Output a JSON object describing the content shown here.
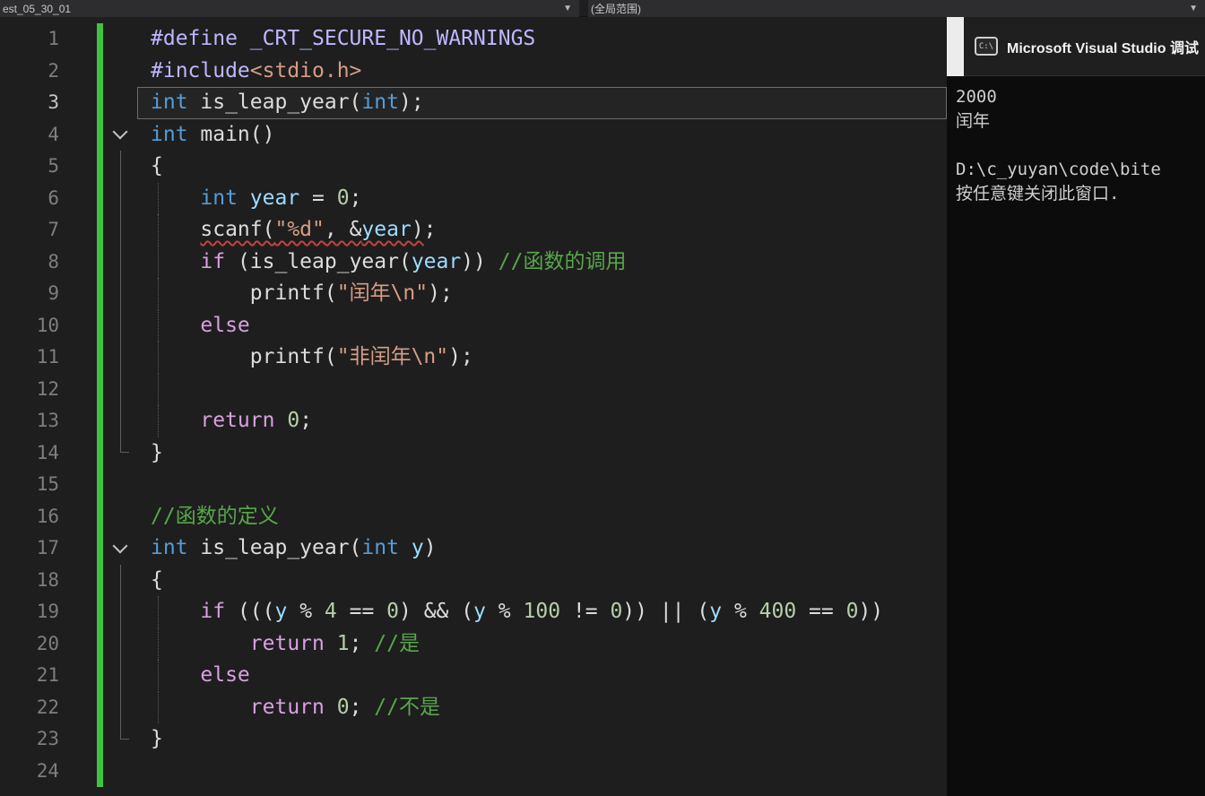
{
  "navbar": {
    "scope_dropdown": {
      "label": "est_05_30_01"
    },
    "member_dropdown": {
      "label": "(全局范围)"
    }
  },
  "palette": {
    "editor_background": "#1e1e1e",
    "keyword_blue": "#569cd6",
    "control_keyword_purple": "#d8a0df",
    "string_orange": "#d69d85",
    "number_green": "#b5cea8",
    "variable_blue": "#9cdcfe",
    "comment_green": "#57a64a",
    "preprocessor_purple": "#beb7ff",
    "changed_line_bar_green": "#3fc43f",
    "squiggle_red": "#c14343",
    "console_background": "#0c0c0c"
  },
  "editor": {
    "fold_ranges": [
      [
        4,
        14
      ],
      [
        17,
        23
      ]
    ],
    "lines": [
      {
        "num": 1,
        "segs": [
          [
            "pre",
            "#define _CRT_SECURE_NO_WARNINGS"
          ]
        ]
      },
      {
        "num": 2,
        "segs": [
          [
            "pre",
            "#include"
          ],
          [
            "str",
            "<stdio.h>"
          ]
        ]
      },
      {
        "num": 3,
        "active": true,
        "segs": [
          [
            "kw",
            "int"
          ],
          [
            "pl",
            " is_leap_year("
          ],
          [
            "kw",
            "int"
          ],
          [
            "pl",
            ");"
          ]
        ]
      },
      {
        "num": 4,
        "chevron": true,
        "segs": [
          [
            "kw",
            "int"
          ],
          [
            "pl",
            " main()"
          ]
        ]
      },
      {
        "num": 5,
        "segs": [
          [
            "pl",
            "{"
          ]
        ]
      },
      {
        "num": 6,
        "guide": true,
        "segs": [
          [
            "pl",
            "    "
          ],
          [
            "kw",
            "int"
          ],
          [
            "pl",
            " "
          ],
          [
            "vr",
            "year"
          ],
          [
            "pl",
            " = "
          ],
          [
            "nm",
            "0"
          ],
          [
            "pl",
            ";"
          ]
        ]
      },
      {
        "num": 7,
        "guide": true,
        "segs": [
          [
            "pl",
            "    "
          ],
          [
            "pl sq",
            "scanf("
          ],
          [
            "str sq",
            "\"%d\""
          ],
          [
            "pl sq",
            ", &"
          ],
          [
            "vr sq",
            "year"
          ],
          [
            "pl sq",
            ")"
          ],
          [
            "pl",
            ";"
          ]
        ]
      },
      {
        "num": 8,
        "guide": true,
        "segs": [
          [
            "pl",
            "    "
          ],
          [
            "ck",
            "if"
          ],
          [
            "pl",
            " (is_leap_year("
          ],
          [
            "vr",
            "year"
          ],
          [
            "pl",
            ")) "
          ],
          [
            "cm",
            "//函数的调用"
          ]
        ]
      },
      {
        "num": 9,
        "guide": true,
        "segs": [
          [
            "pl",
            "        printf("
          ],
          [
            "str",
            "\"闰年\\n\""
          ],
          [
            "pl",
            ");"
          ]
        ]
      },
      {
        "num": 10,
        "guide": true,
        "segs": [
          [
            "pl",
            "    "
          ],
          [
            "ck",
            "else"
          ]
        ]
      },
      {
        "num": 11,
        "guide": true,
        "segs": [
          [
            "pl",
            "        printf("
          ],
          [
            "str",
            "\"非闰年\\n\""
          ],
          [
            "pl",
            ");"
          ]
        ]
      },
      {
        "num": 12,
        "guide": true,
        "segs": []
      },
      {
        "num": 13,
        "guide": true,
        "segs": [
          [
            "pl",
            "    "
          ],
          [
            "ck",
            "return"
          ],
          [
            "pl",
            " "
          ],
          [
            "nm",
            "0"
          ],
          [
            "pl",
            ";"
          ]
        ]
      },
      {
        "num": 14,
        "segs": [
          [
            "pl",
            "}"
          ]
        ]
      },
      {
        "num": 15,
        "segs": []
      },
      {
        "num": 16,
        "segs": [
          [
            "cm",
            "//函数的定义"
          ]
        ]
      },
      {
        "num": 17,
        "chevron": true,
        "segs": [
          [
            "kw",
            "int"
          ],
          [
            "pl",
            " is_leap_year("
          ],
          [
            "kw",
            "int"
          ],
          [
            "pl",
            " "
          ],
          [
            "vr",
            "y"
          ],
          [
            "pl",
            ")"
          ]
        ]
      },
      {
        "num": 18,
        "segs": [
          [
            "pl",
            "{"
          ]
        ]
      },
      {
        "num": 19,
        "guide": true,
        "segs": [
          [
            "pl",
            "    "
          ],
          [
            "ck",
            "if"
          ],
          [
            "pl",
            " ((("
          ],
          [
            "vr",
            "y"
          ],
          [
            "pl",
            " % "
          ],
          [
            "nm",
            "4"
          ],
          [
            "pl",
            " == "
          ],
          [
            "nm",
            "0"
          ],
          [
            "pl",
            ") && ("
          ],
          [
            "vr",
            "y"
          ],
          [
            "pl",
            " % "
          ],
          [
            "nm",
            "100"
          ],
          [
            "pl",
            " != "
          ],
          [
            "nm",
            "0"
          ],
          [
            "pl",
            ")) || ("
          ],
          [
            "vr",
            "y"
          ],
          [
            "pl",
            " % "
          ],
          [
            "nm",
            "400"
          ],
          [
            "pl",
            " == "
          ],
          [
            "nm",
            "0"
          ],
          [
            "pl",
            "))"
          ]
        ]
      },
      {
        "num": 20,
        "guide": true,
        "segs": [
          [
            "pl",
            "        "
          ],
          [
            "ck",
            "return"
          ],
          [
            "pl",
            " "
          ],
          [
            "nm",
            "1"
          ],
          [
            "pl",
            "; "
          ],
          [
            "cm",
            "//是"
          ]
        ]
      },
      {
        "num": 21,
        "guide": true,
        "segs": [
          [
            "pl",
            "    "
          ],
          [
            "ck",
            "else"
          ]
        ]
      },
      {
        "num": 22,
        "guide": true,
        "segs": [
          [
            "pl",
            "        "
          ],
          [
            "ck",
            "return"
          ],
          [
            "pl",
            " "
          ],
          [
            "nm",
            "0"
          ],
          [
            "pl",
            "; "
          ],
          [
            "cm",
            "//不是"
          ]
        ]
      },
      {
        "num": 23,
        "segs": [
          [
            "pl",
            "}"
          ]
        ]
      },
      {
        "num": 24,
        "segs": []
      }
    ]
  },
  "console": {
    "icon": "cmd-console-icon",
    "icon_text": "C:\\",
    "title": "Microsoft Visual Studio 调试",
    "lines": [
      "2000",
      "闰年",
      "",
      "D:\\c_yuyan\\code\\bite",
      "按任意键关闭此窗口."
    ]
  }
}
